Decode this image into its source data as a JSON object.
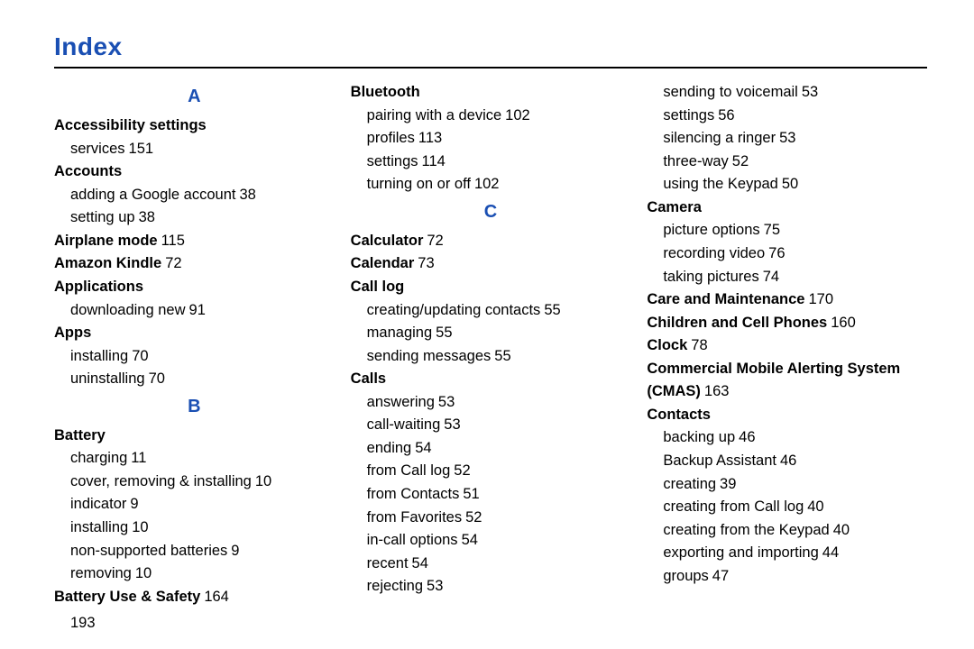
{
  "title": "Index",
  "page_number": "193",
  "colors": {
    "accent": "#1a4fb3"
  },
  "col1": {
    "letterA": "A",
    "accessibility_head": "Accessibility settings",
    "accessibility_services": "services",
    "accessibility_services_pg": "151",
    "accounts_head": "Accounts",
    "accounts_add": "adding a Google account",
    "accounts_add_pg": "38",
    "accounts_setup": "setting up",
    "accounts_setup_pg": "38",
    "airplane_head": "Airplane mode",
    "airplane_pg": "115",
    "kindle_head": "Amazon Kindle",
    "kindle_pg": "72",
    "applications_head": "Applications",
    "applications_dl": "downloading new",
    "applications_dl_pg": "91",
    "apps_head": "Apps",
    "apps_install": "installing",
    "apps_install_pg": "70",
    "apps_uninstall": "uninstalling",
    "apps_uninstall_pg": "70",
    "letterB": "B",
    "battery_head": "Battery",
    "battery_charging": "charging",
    "battery_charging_pg": "11",
    "battery_cover": "cover, removing & installing",
    "battery_cover_pg": "10",
    "battery_indicator": "indicator",
    "battery_indicator_pg": "9",
    "battery_installing": "installing",
    "battery_installing_pg": "10",
    "battery_nonsup": "non-supported batteries",
    "battery_nonsup_pg": "9",
    "battery_removing": "removing",
    "battery_removing_pg": "10",
    "battery_use_head": "Battery Use & Safety",
    "battery_use_pg": "164"
  },
  "col2": {
    "bluetooth_head": "Bluetooth",
    "bt_pair": "pairing with a device",
    "bt_pair_pg": "102",
    "bt_profiles": "profiles",
    "bt_profiles_pg": "113",
    "bt_settings": "settings",
    "bt_settings_pg": "114",
    "bt_toggle": "turning on or off",
    "bt_toggle_pg": "102",
    "letterC": "C",
    "calculator_head": "Calculator",
    "calculator_pg": "72",
    "calendar_head": "Calendar",
    "calendar_pg": "73",
    "calllog_head": "Call log",
    "calllog_create": "creating/updating contacts",
    "calllog_create_pg": "55",
    "calllog_manage": "managing",
    "calllog_manage_pg": "55",
    "calllog_send": "sending messages",
    "calllog_send_pg": "55",
    "calls_head": "Calls",
    "calls_answer": "answering",
    "calls_answer_pg": "53",
    "calls_wait": "call-waiting",
    "calls_wait_pg": "53",
    "calls_end": "ending",
    "calls_end_pg": "54",
    "calls_fromlog": "from Call log",
    "calls_fromlog_pg": "52",
    "calls_fromcontacts": "from Contacts",
    "calls_fromcontacts_pg": "51",
    "calls_fromfav": "from Favorites",
    "calls_fromfav_pg": "52",
    "calls_incall": "in-call options",
    "calls_incall_pg": "54",
    "calls_recent": "recent",
    "calls_recent_pg": "54",
    "calls_reject": "rejecting",
    "calls_reject_pg": "53"
  },
  "col3": {
    "calls_vm": "sending to voicemail",
    "calls_vm_pg": "53",
    "calls_settings": "settings",
    "calls_settings_pg": "56",
    "calls_silence": "silencing a ringer",
    "calls_silence_pg": "53",
    "calls_three": "three-way",
    "calls_three_pg": "52",
    "calls_keypad": "using the Keypad",
    "calls_keypad_pg": "50",
    "camera_head": "Camera",
    "camera_pic": "picture options",
    "camera_pic_pg": "75",
    "camera_record": "recording video",
    "camera_record_pg": "76",
    "camera_take": "taking pictures",
    "camera_take_pg": "74",
    "care_head": "Care and Maintenance",
    "care_pg": "170",
    "children_head": "Children and Cell Phones",
    "children_pg": "160",
    "clock_head": "Clock",
    "clock_pg": "78",
    "cmas_head": "Commercial Mobile Alerting System (CMAS)",
    "cmas_pg": "163",
    "contacts_head": "Contacts",
    "contacts_backup": "backing up",
    "contacts_backup_pg": "46",
    "contacts_assist": "Backup Assistant",
    "contacts_assist_pg": "46",
    "contacts_create": "creating",
    "contacts_create_pg": "39",
    "contacts_fromlog": "creating from Call log",
    "contacts_fromlog_pg": "40",
    "contacts_fromkeypad": "creating from the Keypad",
    "contacts_fromkeypad_pg": "40",
    "contacts_export": "exporting and importing",
    "contacts_export_pg": "44",
    "contacts_groups": "groups",
    "contacts_groups_pg": "47"
  }
}
